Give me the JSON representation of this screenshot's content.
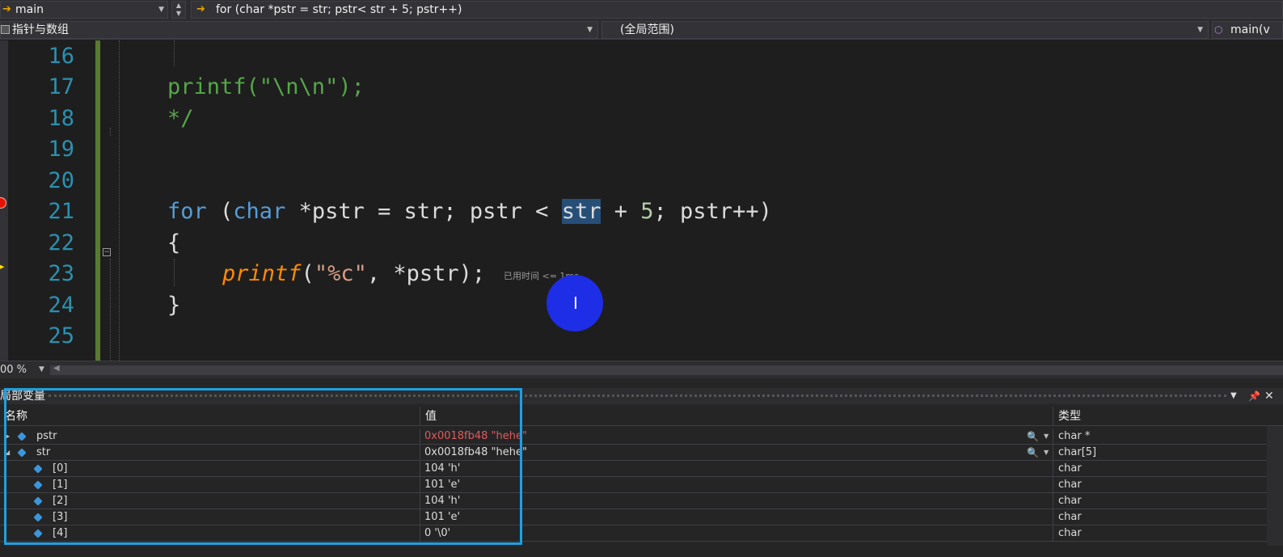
{
  "nav": {
    "function_combo": "main",
    "statement_combo": "for (char *pstr = str; pstr< str + 5; pstr++)",
    "project_combo": "指针与数组",
    "scope_combo": "(全局范围)",
    "member_combo": "main(v"
  },
  "editor": {
    "lines": [
      {
        "num": "16"
      },
      {
        "num": "17",
        "code": "printf(\"\\n\\n\");"
      },
      {
        "num": "18",
        "code": "*/"
      },
      {
        "num": "19"
      },
      {
        "num": "20"
      },
      {
        "num": "21"
      },
      {
        "num": "22",
        "code": "{"
      },
      {
        "num": "23"
      },
      {
        "num": "24",
        "code": "}"
      },
      {
        "num": "25"
      }
    ],
    "line21": {
      "kw1": "for",
      "p1": " (",
      "kw2": "char",
      "p2": " *pstr = str; pstr < ",
      "sel": "str",
      "p3": " + ",
      "n": "5",
      "p4": "; pstr++)"
    },
    "line23": {
      "fn": "printf",
      "p1": "(",
      "str": "\"%c\"",
      "p2": ", *pstr);"
    },
    "elapsed": "已用时间 <= 1ms",
    "zoom": "00 %"
  },
  "locals": {
    "title": "局部变量",
    "columns": {
      "name": "名称",
      "value": "值",
      "type": "类型"
    },
    "rows": [
      {
        "name": "pstr",
        "value": "0x0018fb48 \"hehe\"",
        "type": "char *"
      },
      {
        "name": "str",
        "value": "0x0018fb48 \"hehe\"",
        "type": "char[5]"
      },
      {
        "name": "[0]",
        "value": "104 'h'",
        "type": "char"
      },
      {
        "name": "[1]",
        "value": "101 'e'",
        "type": "char"
      },
      {
        "name": "[2]",
        "value": "104 'h'",
        "type": "char"
      },
      {
        "name": "[3]",
        "value": "101 'e'",
        "type": "char"
      },
      {
        "name": "[4]",
        "value": "0 '\\0'",
        "type": "char"
      }
    ]
  },
  "colors": {
    "keyword": "#569cd6",
    "comment": "#57a64a",
    "function": "#ff8c00",
    "string": "#d69d85",
    "line_number": "#2b91af",
    "highlight_box": "#1fa0e0",
    "changed_value": "#e05a5a"
  }
}
